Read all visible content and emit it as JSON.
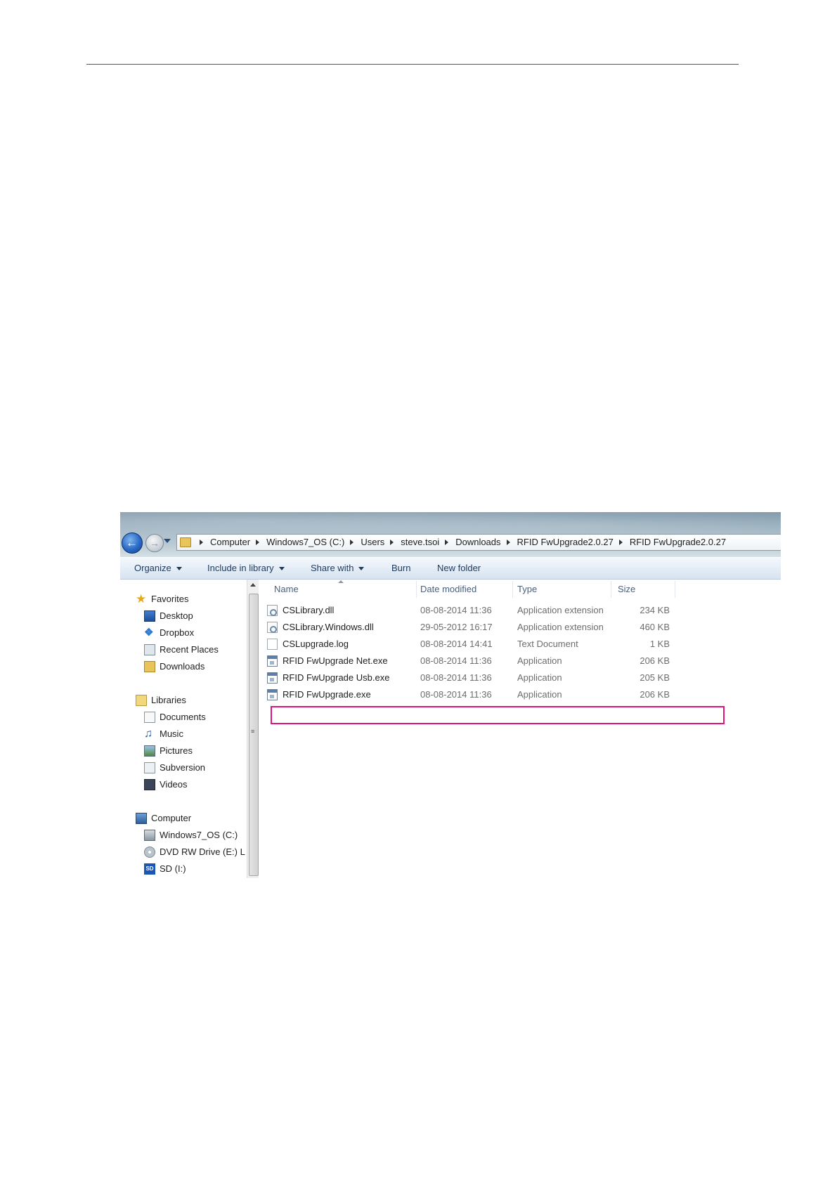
{
  "explorer": {
    "address": {
      "crumbs": [
        "Computer",
        "Windows7_OS (C:)",
        "Users",
        "steve.tsoi",
        "Downloads",
        "RFID FwUpgrade2.0.27",
        "RFID FwUpgrade2.0.27"
      ]
    },
    "toolbar": {
      "organize": "Organize",
      "include_in_library": "Include in library",
      "share_with": "Share with",
      "burn": "Burn",
      "new_folder": "New folder"
    },
    "nav": {
      "favorites": "Favorites",
      "desktop": "Desktop",
      "dropbox": "Dropbox",
      "recent_places": "Recent Places",
      "downloads": "Downloads",
      "libraries": "Libraries",
      "documents": "Documents",
      "music": "Music",
      "pictures": "Pictures",
      "subversion": "Subversion",
      "videos": "Videos",
      "computer": "Computer",
      "windows_os": "Windows7_OS (C:)",
      "dvd": "DVD RW Drive (E:) L",
      "sd": "SD (I:)",
      "sd_icon_text": "SD"
    },
    "columns": {
      "name": "Name",
      "date_modified": "Date modified",
      "type": "Type",
      "size": "Size"
    },
    "files": [
      {
        "name": "CSLibrary.dll",
        "date": "08-08-2014 11:36",
        "type": "Application extension",
        "size": "234 KB",
        "icon": "dll-icon"
      },
      {
        "name": "CSLibrary.Windows.dll",
        "date": "29-05-2012 16:17",
        "type": "Application extension",
        "size": "460 KB",
        "icon": "dll-icon"
      },
      {
        "name": "CSLupgrade.log",
        "date": "08-08-2014 14:41",
        "type": "Text Document",
        "size": "1 KB",
        "icon": "text-document-icon"
      },
      {
        "name": "RFID FwUpgrade Net.exe",
        "date": "08-08-2014 11:36",
        "type": "Application",
        "size": "206 KB",
        "icon": "application-icon"
      },
      {
        "name": "RFID FwUpgrade Usb.exe",
        "date": "08-08-2014 11:36",
        "type": "Application",
        "size": "205 KB",
        "icon": "application-icon"
      },
      {
        "name": "RFID FwUpgrade.exe",
        "date": "08-08-2014 11:36",
        "type": "Application",
        "size": "206 KB",
        "icon": "application-icon"
      }
    ],
    "highlight_color": "#e0147a"
  }
}
